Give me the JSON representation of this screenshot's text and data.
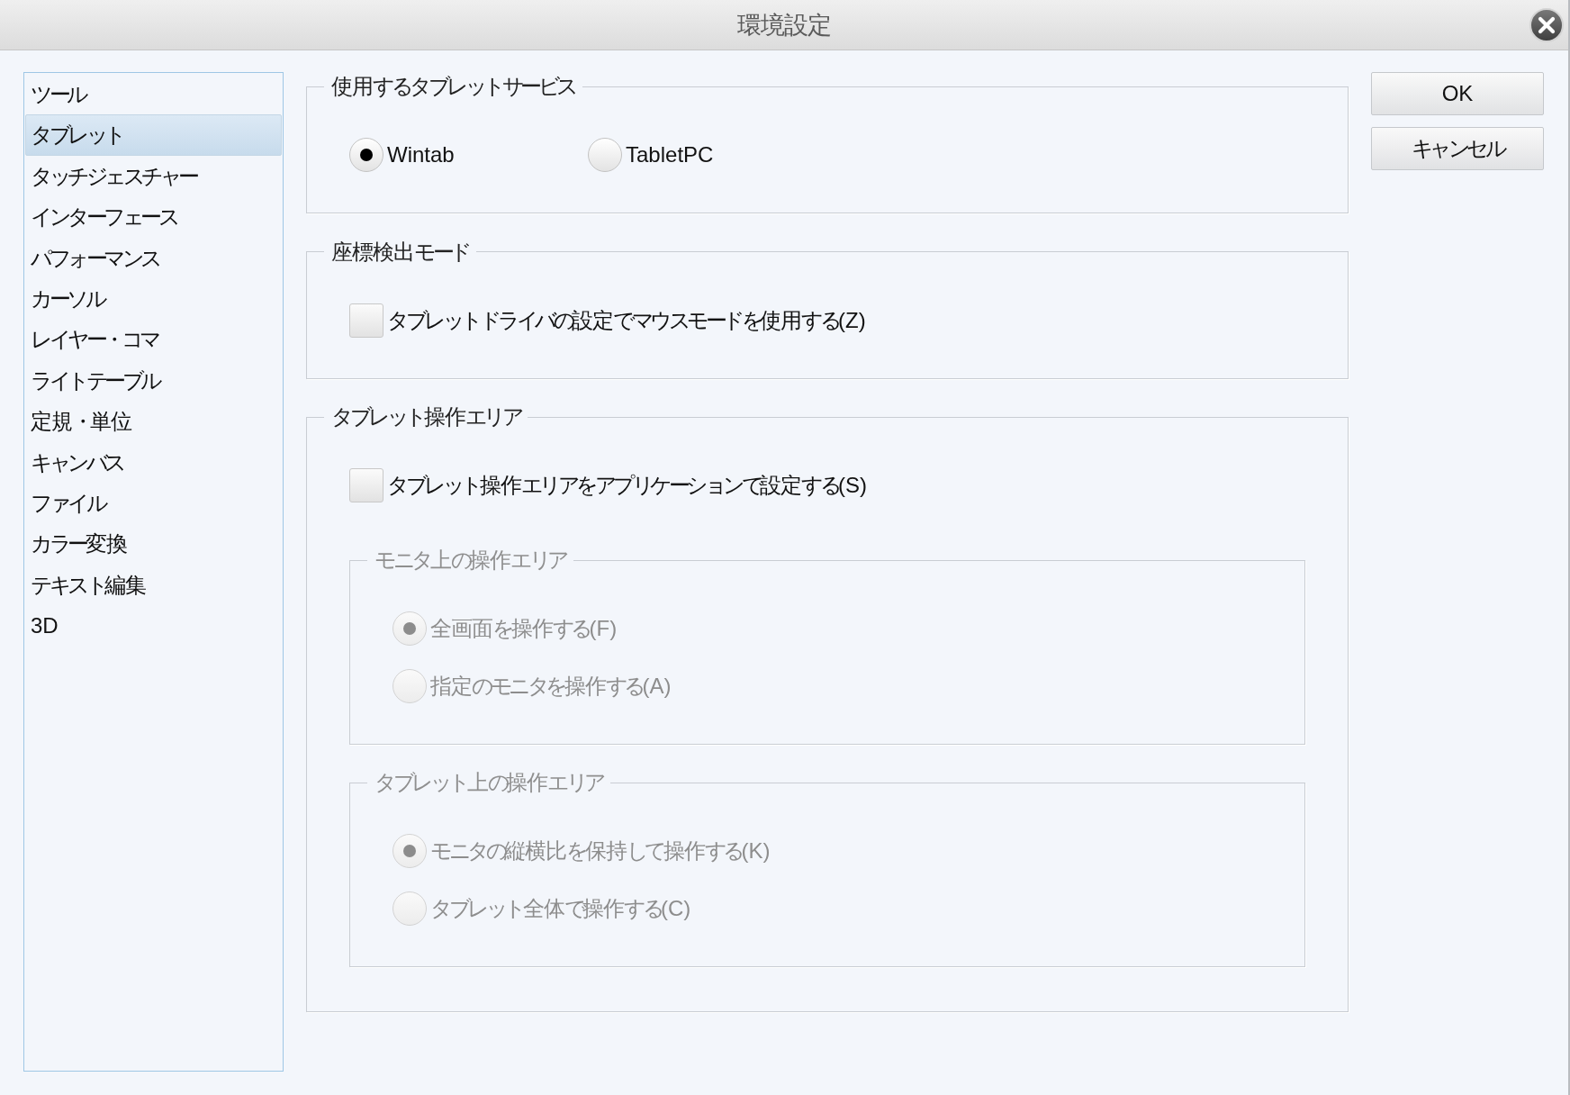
{
  "window": {
    "title": "環境設定"
  },
  "sidebar": {
    "items": [
      {
        "label": "ツール",
        "selected": false
      },
      {
        "label": "タブレット",
        "selected": true
      },
      {
        "label": "タッチジェスチャー",
        "selected": false
      },
      {
        "label": "インターフェース",
        "selected": false
      },
      {
        "label": "パフォーマンス",
        "selected": false
      },
      {
        "label": "カーソル",
        "selected": false
      },
      {
        "label": "レイヤー・コマ",
        "selected": false
      },
      {
        "label": "ライトテーブル",
        "selected": false
      },
      {
        "label": "定規・単位",
        "selected": false
      },
      {
        "label": "キャンバス",
        "selected": false
      },
      {
        "label": "ファイル",
        "selected": false
      },
      {
        "label": "カラー変換",
        "selected": false
      },
      {
        "label": "テキスト編集",
        "selected": false
      },
      {
        "label": "3D",
        "selected": false
      }
    ]
  },
  "groups": [
    {
      "title": "使用するタブレットサービス",
      "kind": "row",
      "options": [
        {
          "kind": "radio",
          "label": "Wintab",
          "selected": true,
          "disabled": false
        },
        {
          "kind": "radio",
          "label": "TabletPC",
          "selected": false,
          "disabled": false
        }
      ]
    },
    {
      "title": "座標検出モード",
      "kind": "stack",
      "options": [
        {
          "kind": "checkbox",
          "label": "タブレットドライバの設定でマウスモードを使用する(Z)",
          "checked": false,
          "disabled": false
        }
      ]
    },
    {
      "title": "タブレット操作エリア",
      "kind": "stack",
      "options": [
        {
          "kind": "checkbox",
          "label": "タブレット操作エリアをアプリケーションで設定する(S)",
          "checked": false,
          "disabled": false
        }
      ],
      "subgroups": [
        {
          "title": "モニタ上の操作エリア",
          "kind": "stack",
          "disabled": true,
          "options": [
            {
              "kind": "radio",
              "label": "全画面を操作する(F)",
              "selected": true,
              "disabled": true
            },
            {
              "kind": "radio",
              "label": "指定のモニタを操作する(A)",
              "selected": false,
              "disabled": true
            }
          ]
        },
        {
          "title": "タブレット上の操作エリア",
          "kind": "stack",
          "disabled": true,
          "options": [
            {
              "kind": "radio",
              "label": "モニタの縦横比を保持して操作する(K)",
              "selected": true,
              "disabled": true
            },
            {
              "kind": "radio",
              "label": "タブレット全体で操作する(C)",
              "selected": false,
              "disabled": true
            }
          ]
        }
      ]
    }
  ],
  "buttons": [
    {
      "label": "OK"
    },
    {
      "label": "キャンセル"
    }
  ]
}
